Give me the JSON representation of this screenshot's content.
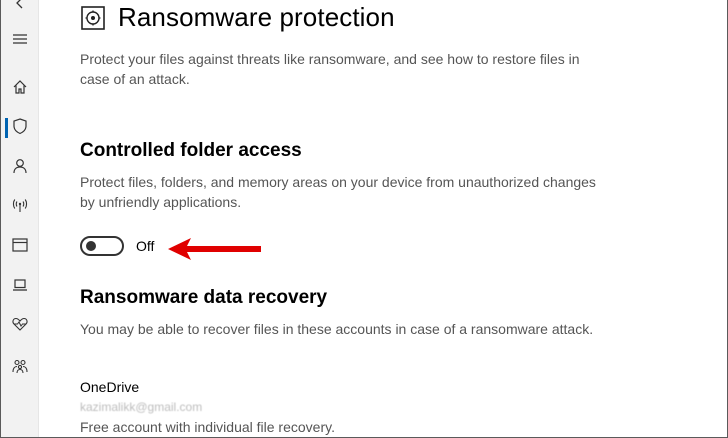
{
  "sidebar": {
    "items": [
      {
        "name": "back",
        "icon": "back-arrow-icon"
      },
      {
        "name": "menu",
        "icon": "hamburger-icon"
      },
      {
        "name": "home",
        "icon": "home-icon"
      },
      {
        "name": "virus-protection",
        "icon": "shield-icon",
        "active": true
      },
      {
        "name": "account-protection",
        "icon": "person-icon"
      },
      {
        "name": "firewall",
        "icon": "wifi-antenna-icon"
      },
      {
        "name": "app-browser-control",
        "icon": "browser-window-icon"
      },
      {
        "name": "device-security",
        "icon": "laptop-icon"
      },
      {
        "name": "device-performance",
        "icon": "heart-pulse-icon"
      },
      {
        "name": "family-options",
        "icon": "family-icon"
      }
    ],
    "accent_color": "#0063b1"
  },
  "page": {
    "title": "Ransomware protection",
    "title_icon": "ransomware-icon",
    "description": "Protect your files against threats like ransomware, and see how to restore files in case of an attack."
  },
  "controlled_folder_access": {
    "title": "Controlled folder access",
    "description": "Protect files, folders, and memory areas on your device from unauthorized changes by unfriendly applications.",
    "toggle_state": "Off"
  },
  "annotation": {
    "arrow_color": "#e00000"
  },
  "data_recovery": {
    "title": "Ransomware data recovery",
    "description": "You may be able to recover files in these accounts in case of a ransomware attack.",
    "account_name": "OneDrive",
    "account_email": "kazimalikk@gmail.com",
    "account_note": "Free account with individual file recovery."
  }
}
